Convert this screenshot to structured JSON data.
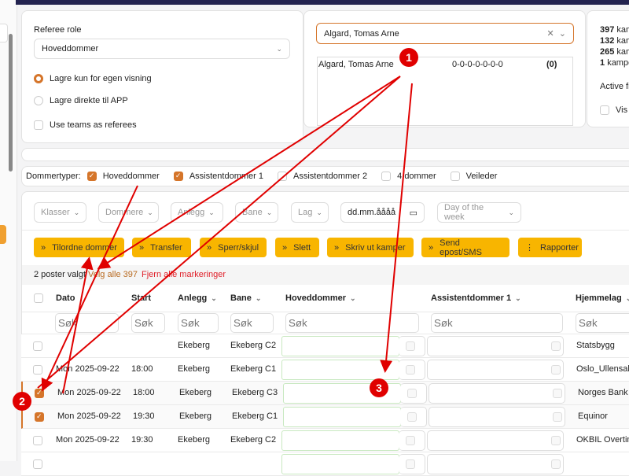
{
  "colors": {
    "accent": "#d5752a",
    "button": "#f8b500",
    "nav": "#23234f",
    "annotation": "#e00000"
  },
  "role": {
    "label": "Referee role",
    "value": "Hoveddommer",
    "options": [
      {
        "label": "Lagre kun for egen visning",
        "checked": true
      },
      {
        "label": "Lagre direkte til APP",
        "checked": false
      }
    ],
    "use_teams": "Use teams as referees"
  },
  "referee": {
    "selected": "Algard, Tomas Arne",
    "list": [
      {
        "name": "Algard, Tomas Arne",
        "stats": "0-0-0-0-0-0-0",
        "count": "(0)"
      }
    ]
  },
  "summary": {
    "lines": [
      {
        "n": "397",
        "t": "kam"
      },
      {
        "n": "132",
        "t": "kam"
      },
      {
        "n": "265",
        "t": "kam"
      },
      {
        "n": "1",
        "t": "kampe"
      }
    ],
    "active": "Active fi",
    "vis": "Vis l"
  },
  "types": {
    "label": "Dommertyper:",
    "items": [
      {
        "label": "Hoveddommer",
        "checked": true
      },
      {
        "label": "Assistentdommer 1",
        "checked": true
      },
      {
        "label": "Assistentdommer 2",
        "checked": false
      },
      {
        "label": "4.dommer",
        "checked": false
      },
      {
        "label": "Veileder",
        "checked": false
      }
    ]
  },
  "filters": {
    "klasser": "Klasser",
    "dommere": "Dommere",
    "anlegg": "Anlegg",
    "bane": "Bane",
    "lag": "Lag",
    "date": "dd.mm.åååå",
    "dow": "Day of the week"
  },
  "actions": [
    "Tilordne dommer",
    "Transfer",
    "Sperr/skjul",
    "Slett",
    "Skriv ut kamper",
    "Send epost/SMS",
    "Rapporter"
  ],
  "selection": {
    "count": "2 poster valgt",
    "select_all": "Velg alle 397",
    "clear": "Fjern alle markeringer"
  },
  "table": {
    "headers": {
      "dato": "Dato",
      "start": "Start",
      "anlegg": "Anlegg",
      "bane": "Bane",
      "hoved": "Hoveddommer",
      "ass1": "Assistentdommer 1",
      "hjemme": "Hjemmelag"
    },
    "search_placeholder": "Søk",
    "rows": [
      {
        "dato": "",
        "start": "",
        "anlegg": "Ekeberg",
        "bane": "Ekeberg C2",
        "hjemme": "Statsbygg",
        "checked": false
      },
      {
        "dato": "Mon 2025-09-22",
        "start": "18:00",
        "anlegg": "Ekeberg",
        "bane": "Ekeberg C1",
        "hjemme": "Oslo_Ullensaker",
        "checked": false
      },
      {
        "dato": "Mon 2025-09-22",
        "start": "18:00",
        "anlegg": "Ekeberg",
        "bane": "Ekeberg C3",
        "hjemme": "Norges Bank",
        "checked": true
      },
      {
        "dato": "Mon 2025-09-22",
        "start": "19:30",
        "anlegg": "Ekeberg",
        "bane": "Ekeberg C1",
        "hjemme": "Equinor",
        "checked": true
      },
      {
        "dato": "Mon 2025-09-22",
        "start": "19:30",
        "anlegg": "Ekeberg",
        "bane": "Ekeberg C2",
        "hjemme": "OKBIL Overtime",
        "checked": false
      }
    ]
  },
  "annotations": [
    "1",
    "2",
    "3"
  ]
}
